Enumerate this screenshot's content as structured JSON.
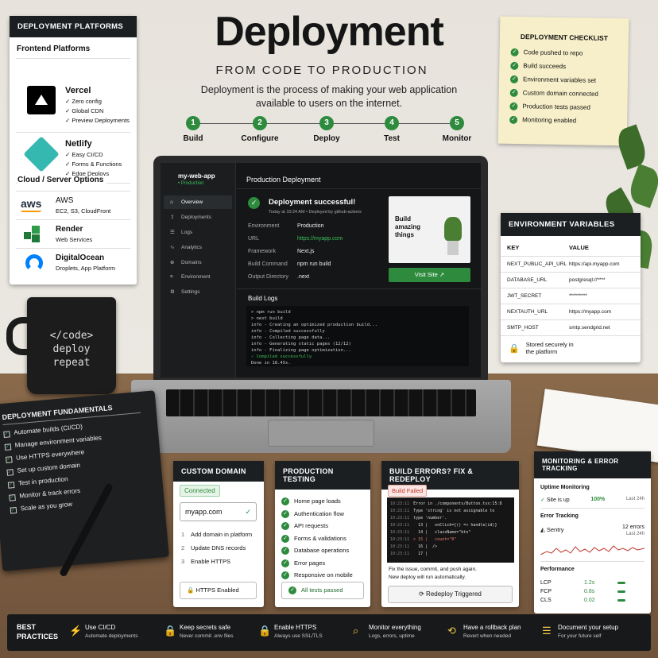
{
  "header": {
    "title": "Deployment",
    "subtitle": "FROM CODE TO PRODUCTION",
    "desc1": "Deployment is the process of making your web application",
    "desc2": "available to users on the internet."
  },
  "steps": [
    {
      "num": "1",
      "label": "Build"
    },
    {
      "num": "2",
      "label": "Configure"
    },
    {
      "num": "3",
      "label": "Deploy"
    },
    {
      "num": "4",
      "label": "Test"
    },
    {
      "num": "5",
      "label": "Monitor"
    }
  ],
  "platforms": {
    "title": "DEPLOYMENT PLATFORMS",
    "frontend_heading": "Frontend Platforms",
    "cloud_heading": "Cloud / Server Options",
    "vercel": {
      "name": "Vercel",
      "features": [
        "Zero config",
        "Global CDN",
        "Preview Deployments"
      ]
    },
    "netlify": {
      "name": "Netlify",
      "features": [
        "Easy CI/CD",
        "Forms & Functions",
        "Edge Deploys"
      ]
    },
    "aws": {
      "name": "AWS",
      "desc": "EC2, S3, CloudFront"
    },
    "render": {
      "name": "Render",
      "desc": "Web Services"
    },
    "digitalocean": {
      "name": "DigitalOcean",
      "desc": "Droplets, App Platform"
    }
  },
  "checklist": {
    "title": "DEPLOYMENT CHECKLIST",
    "items": [
      "Code pushed to repo",
      "Build succeeds",
      "Environment variables set",
      "Custom domain connected",
      "Production tests passed",
      "Monitoring enabled"
    ]
  },
  "env": {
    "title": "ENVIRONMENT VARIABLES",
    "key_header": "KEY",
    "value_header": "VALUE",
    "rows": [
      [
        "NEXT_PUBLIC_API_URL",
        "https://api.myapp.com"
      ],
      [
        "DATABASE_URL",
        "postgresql://****"
      ],
      [
        "JWT_SECRET",
        "*********"
      ],
      [
        "NEXTAUTH_URL",
        "https://myapp.com"
      ],
      [
        "SMTP_HOST",
        "smtp.sendgrid.net"
      ]
    ],
    "footer1": "Stored securely in",
    "footer2": "the platform"
  },
  "mug": {
    "line1": "</code>",
    "line2": "deploy",
    "line3": "repeat"
  },
  "dashboard": {
    "app_name": "my-web-app",
    "app_env": "• Production",
    "nav": [
      "Overview",
      "Deployments",
      "Logs",
      "Analytics",
      "Domains",
      "Environment",
      "Settings"
    ],
    "heading": "Production Deployment",
    "success": "Deployment successful!",
    "meta": "Today at 10:24 AM  •  Deployed by github-actions",
    "details": [
      [
        "Environment",
        "Production"
      ],
      [
        "URL",
        "https://myapp.com"
      ],
      [
        "Framework",
        "Next.js"
      ],
      [
        "Build Command",
        "npm run build"
      ],
      [
        "Output Directory",
        ".next"
      ]
    ],
    "preview_text": "Build amazing things",
    "visit": "Visit Site",
    "logs_title": "Build Logs",
    "logs": [
      "> npm run build",
      "> next build",
      "info  - Creating an optimized production build...",
      "info  - Compiled successfully",
      "info  - Collecting page data...",
      "info  - Generating static pages (12/12)",
      "info  - Finalizing page optimization...",
      "✓ Compiled successfully",
      "Done in 18.45s."
    ]
  },
  "fundamentals": {
    "title": "DEPLOYMENT FUNDAMENTALS",
    "items": [
      "Automate builds (CI/CD)",
      "Manage environment variables",
      "Use HTTPS everywhere",
      "Set up custom domain",
      "Test in production",
      "Monitor & track errors",
      "Scale as you grow"
    ]
  },
  "domain": {
    "title": "CUSTOM DOMAIN",
    "badge": "Connected",
    "value": "myapp.com",
    "steps": [
      "Add domain in platform",
      "Update DNS records",
      "Enable HTTPS"
    ],
    "footer": "HTTPS Enabled"
  },
  "testing": {
    "title": "PRODUCTION TESTING",
    "items": [
      "Home page loads",
      "Authentication flow",
      "API requests",
      "Forms & validations",
      "Database operations",
      "Error pages",
      "Responsive on mobile"
    ],
    "footer": "All tests passed"
  },
  "errors": {
    "title": "BUILD ERRORS? FIX & REDEPLOY",
    "badge": "Build Failed",
    "code": [
      [
        "10:23:11",
        "Error in ./components/Button.tsx:15:8"
      ],
      [
        "10:23:11",
        "Type 'string' is not assignable to"
      ],
      [
        "10:23:11",
        "type 'number'."
      ],
      [
        "10:23:11",
        "  13 |   onClick={() => handle(id)}"
      ],
      [
        "10:23:11",
        "  14 |   className=\"btn\""
      ],
      [
        "10:23:11",
        "> 15 |   count=\"8\""
      ],
      [
        "10:23:11",
        "  16 |  />"
      ],
      [
        "10:23:11",
        "  17 |"
      ]
    ],
    "note1": "Fix the issue, commit, and push again.",
    "note2": "New deploy will run automatically.",
    "button": "Redeploy Triggered"
  },
  "monitoring": {
    "title": "MONITORING & ERROR TRACKING",
    "uptime_heading": "Uptime Monitoring",
    "uptime_label": "Site is up",
    "uptime_pct": "100%",
    "uptime_window": "Last 24h",
    "error_heading": "Error Tracking",
    "sentry": "Sentry",
    "errors_count": "12 errors",
    "errors_window": "Last 24h",
    "perf_heading": "Performance",
    "metrics": [
      [
        "LCP",
        "1.2s"
      ],
      [
        "FCP",
        "0.8s"
      ],
      [
        "CLS",
        "0.02"
      ]
    ]
  },
  "practices": {
    "title1": "BEST",
    "title2": "PRACTICES",
    "items": [
      [
        "Use CI/CD",
        "Automate deployments"
      ],
      [
        "Keep secrets safe",
        "Never commit .env files"
      ],
      [
        "Enable HTTPS",
        "Always use SSL/TLS"
      ],
      [
        "Monitor everything",
        "Logs, errors, uptime"
      ],
      [
        "Have a rollback plan",
        "Revert when needed"
      ],
      [
        "Document your setup",
        "For your future self"
      ]
    ]
  },
  "colors": {
    "green": "#2e8b3e",
    "dark": "#1b1f22",
    "accent_bright": "#3fbf5a"
  }
}
